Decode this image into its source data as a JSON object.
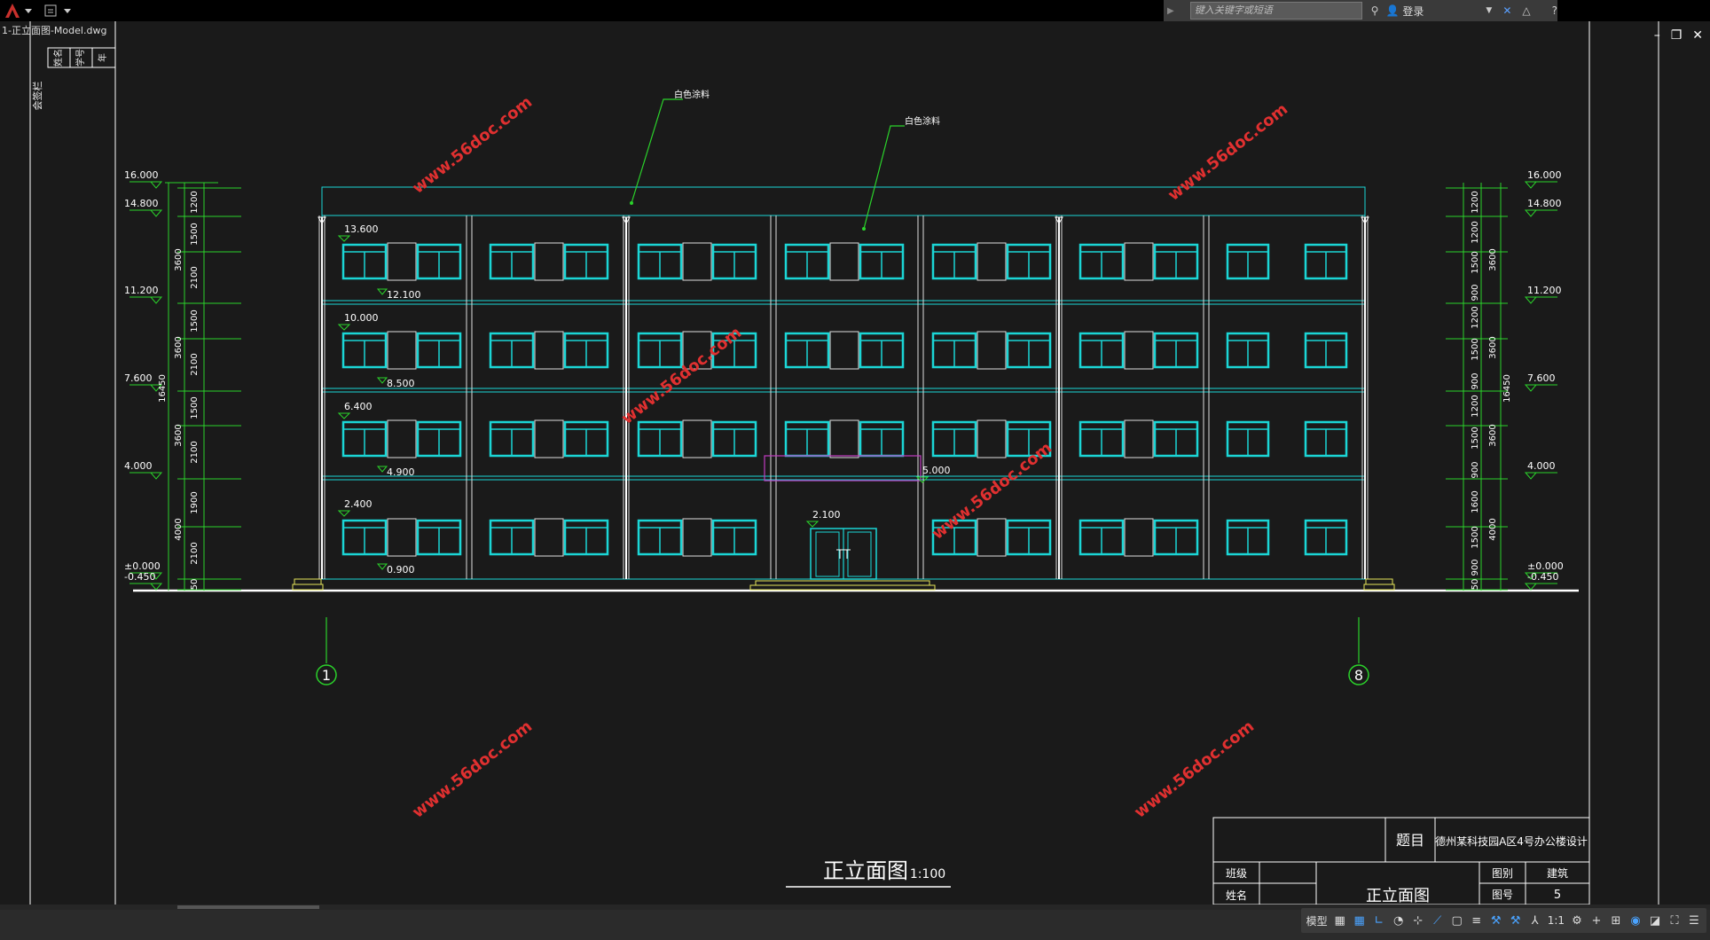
{
  "app": {
    "search_placeholder": "键入关键字或短语",
    "login_label": "登录",
    "file_tab": "1-正立面图-Model.dwg"
  },
  "drawing": {
    "title": "正立面图",
    "scale": "1:100",
    "paint_notes": [
      "白色涂料",
      "白色涂料"
    ],
    "elevations_left": [
      "16.000",
      "14.800",
      "11.200",
      "7.600",
      "4.000",
      "±0.000",
      "-0.450"
    ],
    "elevations_right": [
      "16.000",
      "14.800",
      "11.200",
      "7.600",
      "4.000",
      "±0.000",
      "-0.450"
    ],
    "floor_marks": [
      "13.600",
      "12.100",
      "10.000",
      "8.500",
      "6.400",
      "4.900",
      "2.400",
      "0.900",
      "2.100",
      "5.000"
    ],
    "dims_left_inner": [
      "1200",
      "1500",
      "2100",
      "1500",
      "2100",
      "1500",
      "2100",
      "1900",
      "2100",
      "50"
    ],
    "dims_left_outer": [
      "3600",
      "3600",
      "3600",
      "4000"
    ],
    "total_height": "16450",
    "dims_right_inner": [
      "1200",
      "1200",
      "1500",
      "900",
      "1200",
      "1500",
      "900",
      "1200",
      "1500",
      "900",
      "1600",
      "1500",
      "900",
      "50"
    ],
    "dims_right_outer": [
      "3600",
      "3600",
      "3600",
      "4000"
    ],
    "axis_labels": [
      "1",
      "8"
    ],
    "watermark": "www.56doc.com",
    "side_table_labels": [
      "姓名",
      "学号",
      "年"
    ],
    "side_vertical_text": "会签栏"
  },
  "title_block": {
    "topic_label": "题目",
    "topic_value": "德州某科技园A区4号办公楼设计",
    "class_label": "班级",
    "name_label": "姓名",
    "drawing_name": "正立面图",
    "category_label": "图别",
    "category_value": "建筑",
    "number_label": "图号",
    "number_value": "5"
  },
  "status": {
    "model_tab": "模型",
    "scale": "1:1"
  }
}
